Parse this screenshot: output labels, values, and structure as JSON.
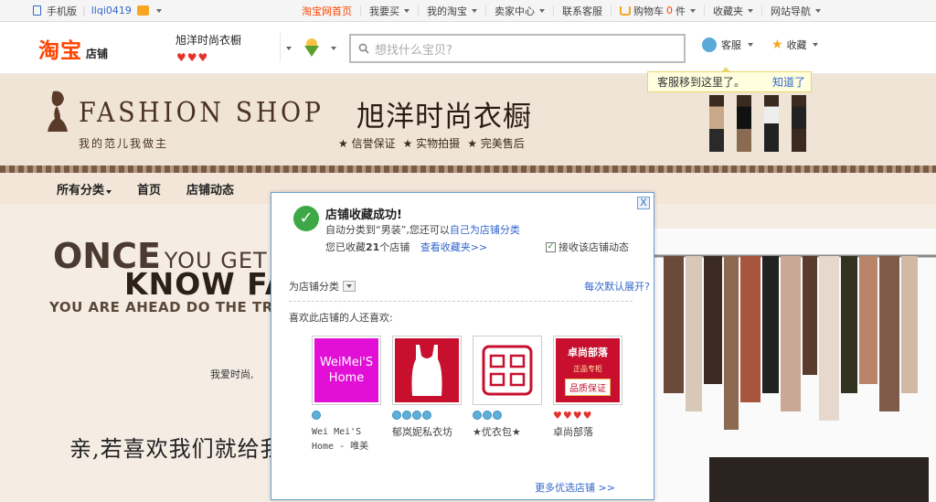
{
  "topbar": {
    "mobile": "手机版",
    "username": "llqi0419",
    "items": [
      {
        "label": "淘宝网首页",
        "highlight": true,
        "caret": false
      },
      {
        "label": "我要买",
        "caret": true
      },
      {
        "label": "我的淘宝",
        "caret": true
      },
      {
        "label": "卖家中心",
        "caret": true
      },
      {
        "label": "联系客服",
        "caret": false
      },
      {
        "label": "购物车",
        "caret": true,
        "count": "0",
        "unit": "件"
      },
      {
        "label": "收藏夹",
        "caret": true
      },
      {
        "label": "网站导航",
        "caret": true
      }
    ]
  },
  "header": {
    "logo": "淘宝",
    "logo_sub": "店铺",
    "shop_name": "旭洋时尚衣橱",
    "hearts": 3,
    "search_placeholder": "想找什么宝贝?",
    "kefu": "客服",
    "favorite": "收藏",
    "tooltip_text": "客服移到这里了。",
    "tooltip_link": "知道了"
  },
  "banner": {
    "brand": "FASHION SHOP",
    "tagline": "我的范儿我做主",
    "title": "旭洋时尚衣橱",
    "slogans": [
      "信誉保证",
      "实物拍摄",
      "完美售后"
    ]
  },
  "nav": {
    "items": [
      "所有分类",
      "首页",
      "店铺动态"
    ]
  },
  "hero": {
    "once": "ONCE",
    "you_get": "YOU GET",
    "know": "KNOW FA",
    "ahead": "YOU ARE AHEAD DO THE TREN",
    "aishang": "我爱时尚,",
    "qin": "亲,若喜欢我们就给我"
  },
  "dialog": {
    "title": "店铺收藏成功!",
    "line1_pre": "自动分类到“男装”,您还可以",
    "line1_link": "自己为店铺分类",
    "line2_pre": "您已收藏",
    "fav_count": "21",
    "line2_post": "个店铺",
    "view_link": "查看收藏夹>>",
    "receive": "接收该店铺动态",
    "category_label": "为店铺分类",
    "default_open": "每次默认展开?",
    "also_like": "喜欢此店铺的人还喜欢:",
    "shops": [
      {
        "name_line1": "Wei Mei'S",
        "name_line2": "Home - 唯美",
        "thumb_text": "WeiMei'S Home",
        "rank_type": "crown",
        "rank_count": 1,
        "thumb_color": "#e20fd6"
      },
      {
        "name_line1": "郁岚妮私衣坊",
        "name_line2": "",
        "thumb_text": "",
        "rank_type": "crown",
        "rank_count": 4,
        "thumb_color": "#c8102e"
      },
      {
        "name_line1": "★优衣包★",
        "name_line2": "",
        "thumb_text": "",
        "rank_type": "crown",
        "rank_count": 3,
        "thumb_color": "#ffffff"
      },
      {
        "name_line1": "卓尚部落",
        "name_line2": "",
        "thumb_text": "卓尚部落",
        "thumb_sub": "品质保证",
        "thumb_tag": "正品专柜",
        "rank_type": "heart",
        "rank_count": 4,
        "thumb_color": "#c8102e"
      }
    ],
    "more": "更多优选店铺 >>",
    "close": "X"
  }
}
